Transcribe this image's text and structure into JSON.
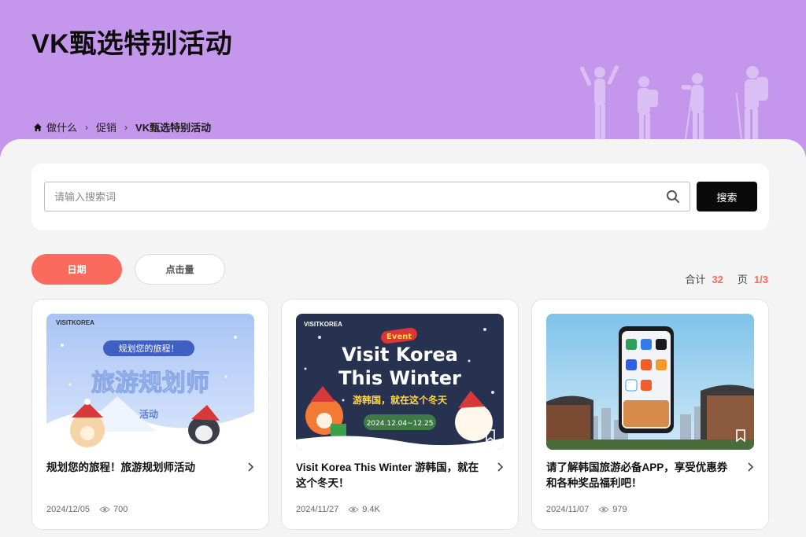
{
  "hero": {
    "title": "VK甄选特别活动",
    "breadcrumb": [
      "做什么",
      "促销",
      "VK甄选特别活动"
    ]
  },
  "search": {
    "placeholder": "请输入搜索词",
    "button_label": "搜索"
  },
  "sort": {
    "date_label": "日期",
    "clicks_label": "点击量",
    "active": "date"
  },
  "summary": {
    "total_label": "合计",
    "total_count": "32",
    "page_label": "页",
    "page_value": "1/3"
  },
  "cards": [
    {
      "title": "规划您的旅程！旅游规划师活动",
      "date": "2024/12/05",
      "views": "700",
      "image": {
        "logo": "VISITKOREA",
        "banner": "规划您的旅程！",
        "headline": "旅游规划师",
        "sub": "活动"
      }
    },
    {
      "title": "Visit Korea This Winter 游韩国，就在这个冬天！",
      "date": "2024/11/27",
      "views": "9.4K",
      "image": {
        "logo": "VISITKOREA",
        "badge": "Event",
        "line1": "Visit Korea",
        "line2": "This Winter",
        "sub": "游韩国，就在这个冬天",
        "dates": "2024.12.04~12.25"
      }
    },
    {
      "title": "请了解韩国旅游必备APP，享受优惠券和各种奖品福利吧！",
      "date": "2024/11/07",
      "views": "979",
      "image": {}
    }
  ],
  "colors": {
    "hero_bg": "#c497ec",
    "accent": "#fb6b5d",
    "button_dark": "#0a0a0a"
  }
}
